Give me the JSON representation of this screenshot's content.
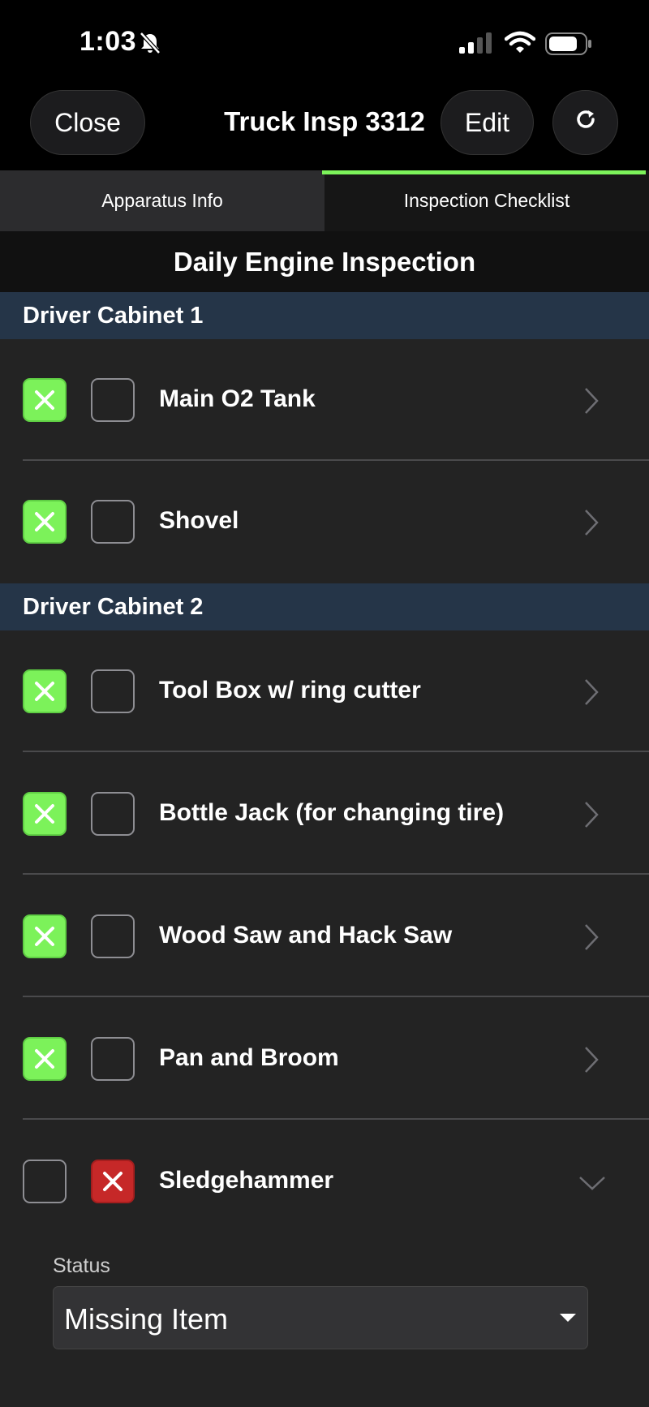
{
  "status_bar": {
    "time": "1:03"
  },
  "nav": {
    "close_label": "Close",
    "title": "Truck Insp 3312",
    "edit_label": "Edit"
  },
  "tabs": [
    {
      "label": "Apparatus Info",
      "active": false
    },
    {
      "label": "Inspection Checklist",
      "active": true
    }
  ],
  "checklist_title": "Daily Engine Inspection",
  "sections": [
    {
      "title": "Driver Cabinet 1",
      "items": [
        {
          "label": "Main O2 Tank",
          "ok": true,
          "missing": false
        },
        {
          "label": "Shovel",
          "ok": true,
          "missing": false
        }
      ]
    },
    {
      "title": "Driver Cabinet 2",
      "items": [
        {
          "label": "Tool Box w/ ring cutter",
          "ok": true,
          "missing": false
        },
        {
          "label": "Bottle Jack (for changing tire)",
          "ok": true,
          "missing": false
        },
        {
          "label": "Wood Saw and Hack Saw",
          "ok": true,
          "missing": false
        },
        {
          "label": "Pan and Broom",
          "ok": true,
          "missing": false
        },
        {
          "label": "Sledgehammer",
          "ok": false,
          "missing": true,
          "expanded": true
        }
      ]
    }
  ],
  "detail": {
    "status_label": "Status",
    "status_value": "Missing Item"
  },
  "colors": {
    "accent_green": "#7cf25a",
    "alert_red": "#c62828",
    "section_header": "#253548"
  },
  "icons": [
    "bell-slash-icon",
    "signal-icon",
    "wifi-icon",
    "battery-icon",
    "refresh-icon",
    "chevron-right-icon",
    "chevron-down-icon",
    "x-mark-icon",
    "caret-down-icon"
  ]
}
